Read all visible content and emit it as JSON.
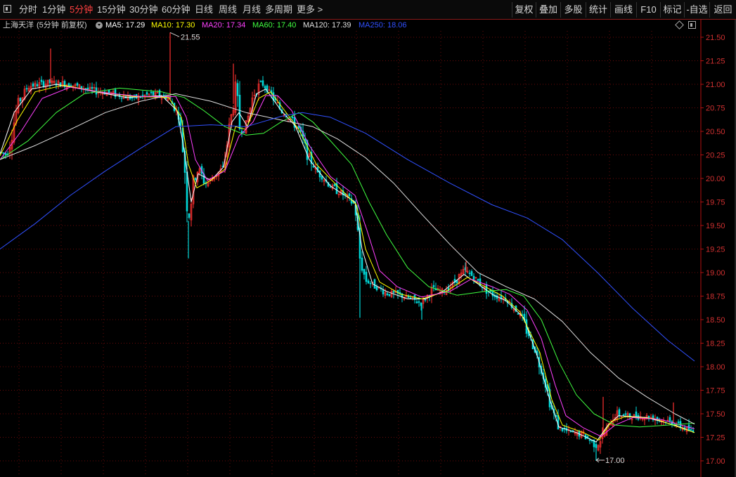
{
  "toolbar": {
    "periods": [
      "分时",
      "1分钟",
      "5分钟",
      "15分钟",
      "30分钟",
      "60分钟",
      "日线",
      "周线",
      "月线",
      "多周期",
      "更多 >"
    ],
    "active_period": "5分钟",
    "right_buttons": [
      "复权",
      "叠加",
      "多股",
      "统计",
      "画线",
      "F10",
      "标记",
      "-自选",
      "返回"
    ]
  },
  "indicator": {
    "stock_name": "上海天洋",
    "period_label": "(5分钟 前复权)",
    "ma": [
      {
        "label": "MA5: 17.29",
        "color": "#ffffff"
      },
      {
        "label": "MA10: 17.30",
        "color": "#ffff00"
      },
      {
        "label": "MA20: 17.34",
        "color": "#ff40ff"
      },
      {
        "label": "MA60: 17.40",
        "color": "#40ff40"
      },
      {
        "label": "MA120: 17.39",
        "color": "#e0e0e0"
      },
      {
        "label": "MA250: 18.06",
        "color": "#3050ff"
      }
    ]
  },
  "colors": {
    "up": "#ff3030",
    "down": "#00d8d8",
    "axis": "#b01010",
    "grid": "#6a0a0a",
    "axis_text": "#d03030"
  },
  "chart_data": {
    "type": "candlestick",
    "y_axis_ticks": [
      "21.50",
      "21.25",
      "21.00",
      "20.75",
      "20.50",
      "20.25",
      "20.00",
      "19.75",
      "19.50",
      "19.25",
      "19.00",
      "18.75",
      "18.50",
      "18.25",
      "18.00",
      "17.75",
      "17.50",
      "17.25",
      "17.00"
    ],
    "ylim": [
      16.96,
      21.68
    ],
    "annotations": {
      "high_label": "21.55",
      "high_value": 21.55,
      "low_label": "17.00",
      "low_value": 17.0
    },
    "price_path": [
      [
        0,
        20.28
      ],
      [
        10,
        20.25
      ],
      [
        25,
        20.78
      ],
      [
        40,
        20.98
      ],
      [
        70,
        21.02
      ],
      [
        100,
        21.0
      ],
      [
        130,
        20.94
      ],
      [
        160,
        20.9
      ],
      [
        190,
        20.85
      ],
      [
        215,
        20.9
      ],
      [
        240,
        20.86
      ],
      [
        255,
        20.66
      ],
      [
        262,
        20.2
      ],
      [
        268,
        19.55
      ],
      [
        274,
        19.9
      ],
      [
        282,
        20.12
      ],
      [
        292,
        19.94
      ],
      [
        305,
        20.02
      ],
      [
        318,
        20.12
      ],
      [
        328,
        20.62
      ],
      [
        335,
        20.92
      ],
      [
        342,
        20.5
      ],
      [
        350,
        20.56
      ],
      [
        360,
        20.88
      ],
      [
        372,
        21.02
      ],
      [
        385,
        20.9
      ],
      [
        400,
        20.72
      ],
      [
        415,
        20.62
      ],
      [
        425,
        20.52
      ],
      [
        435,
        20.3
      ],
      [
        450,
        20.08
      ],
      [
        470,
        19.92
      ],
      [
        490,
        19.82
      ],
      [
        505,
        19.72
      ],
      [
        512,
        19.15
      ],
      [
        520,
        18.92
      ],
      [
        535,
        18.85
      ],
      [
        550,
        18.78
      ],
      [
        570,
        18.76
      ],
      [
        585,
        18.72
      ],
      [
        600,
        18.67
      ],
      [
        615,
        18.82
      ],
      [
        630,
        18.8
      ],
      [
        645,
        18.88
      ],
      [
        660,
        19.02
      ],
      [
        675,
        18.95
      ],
      [
        690,
        18.82
      ],
      [
        705,
        18.75
      ],
      [
        720,
        18.72
      ],
      [
        740,
        18.55
      ],
      [
        760,
        18.2
      ],
      [
        775,
        17.85
      ],
      [
        785,
        17.55
      ],
      [
        795,
        17.36
      ],
      [
        810,
        17.3
      ],
      [
        830,
        17.28
      ],
      [
        848,
        17.16
      ],
      [
        862,
        17.32
      ],
      [
        875,
        17.5
      ],
      [
        900,
        17.47
      ],
      [
        920,
        17.47
      ],
      [
        940,
        17.44
      ],
      [
        960,
        17.4
      ],
      [
        975,
        17.34
      ],
      [
        988,
        17.3
      ]
    ],
    "spikes": [
      [
        72,
        21.38
      ],
      [
        242,
        21.55
      ],
      [
        268,
        19.15
      ],
      [
        332,
        21.22
      ],
      [
        512,
        18.52
      ],
      [
        600,
        18.5
      ],
      [
        663,
        19.12
      ],
      [
        848,
        17.0
      ],
      [
        858,
        17.68
      ],
      [
        958,
        17.62
      ]
    ],
    "ma_series": [
      {
        "name": "MA5",
        "color": "#ffffff",
        "points": [
          [
            0,
            20.26
          ],
          [
            20,
            20.7
          ],
          [
            45,
            20.95
          ],
          [
            80,
            21.0
          ],
          [
            130,
            20.93
          ],
          [
            180,
            20.86
          ],
          [
            230,
            20.88
          ],
          [
            252,
            20.72
          ],
          [
            262,
            20.3
          ],
          [
            272,
            19.75
          ],
          [
            282,
            20.05
          ],
          [
            300,
            19.98
          ],
          [
            318,
            20.12
          ],
          [
            330,
            20.6
          ],
          [
            340,
            20.7
          ],
          [
            352,
            20.55
          ],
          [
            365,
            20.9
          ],
          [
            378,
            20.95
          ],
          [
            400,
            20.72
          ],
          [
            420,
            20.56
          ],
          [
            440,
            20.2
          ],
          [
            470,
            19.92
          ],
          [
            505,
            19.75
          ],
          [
            515,
            19.25
          ],
          [
            530,
            18.88
          ],
          [
            550,
            18.8
          ],
          [
            580,
            18.72
          ],
          [
            605,
            18.72
          ],
          [
            630,
            18.8
          ],
          [
            660,
            18.98
          ],
          [
            680,
            18.88
          ],
          [
            700,
            18.77
          ],
          [
            720,
            18.7
          ],
          [
            745,
            18.52
          ],
          [
            765,
            18.1
          ],
          [
            780,
            17.7
          ],
          [
            795,
            17.36
          ],
          [
            820,
            17.3
          ],
          [
            848,
            17.2
          ],
          [
            865,
            17.38
          ],
          [
            880,
            17.48
          ],
          [
            920,
            17.46
          ],
          [
            960,
            17.38
          ],
          [
            988,
            17.3
          ]
        ]
      },
      {
        "name": "MA10",
        "color": "#ffff00",
        "points": [
          [
            0,
            20.24
          ],
          [
            25,
            20.62
          ],
          [
            50,
            20.92
          ],
          [
            90,
            20.99
          ],
          [
            140,
            20.92
          ],
          [
            190,
            20.87
          ],
          [
            240,
            20.86
          ],
          [
            258,
            20.65
          ],
          [
            268,
            20.15
          ],
          [
            280,
            19.9
          ],
          [
            300,
            19.98
          ],
          [
            320,
            20.1
          ],
          [
            335,
            20.55
          ],
          [
            350,
            20.52
          ],
          [
            368,
            20.85
          ],
          [
            385,
            20.92
          ],
          [
            405,
            20.72
          ],
          [
            425,
            20.52
          ],
          [
            450,
            20.15
          ],
          [
            480,
            19.92
          ],
          [
            507,
            19.72
          ],
          [
            520,
            19.25
          ],
          [
            540,
            18.9
          ],
          [
            570,
            18.77
          ],
          [
            600,
            18.72
          ],
          [
            635,
            18.8
          ],
          [
            665,
            18.95
          ],
          [
            690,
            18.85
          ],
          [
            715,
            18.75
          ],
          [
            740,
            18.58
          ],
          [
            768,
            18.15
          ],
          [
            785,
            17.65
          ],
          [
            800,
            17.38
          ],
          [
            830,
            17.3
          ],
          [
            852,
            17.22
          ],
          [
            870,
            17.42
          ],
          [
            890,
            17.47
          ],
          [
            930,
            17.45
          ],
          [
            965,
            17.36
          ],
          [
            988,
            17.3
          ]
        ]
      },
      {
        "name": "MA20",
        "color": "#ff40ff",
        "points": [
          [
            0,
            20.2
          ],
          [
            30,
            20.5
          ],
          [
            60,
            20.85
          ],
          [
            100,
            20.97
          ],
          [
            150,
            20.91
          ],
          [
            200,
            20.87
          ],
          [
            250,
            20.87
          ],
          [
            265,
            20.65
          ],
          [
            278,
            20.2
          ],
          [
            295,
            19.98
          ],
          [
            320,
            20.08
          ],
          [
            340,
            20.45
          ],
          [
            360,
            20.6
          ],
          [
            378,
            20.88
          ],
          [
            395,
            20.88
          ],
          [
            415,
            20.72
          ],
          [
            440,
            20.35
          ],
          [
            470,
            20.02
          ],
          [
            505,
            19.82
          ],
          [
            522,
            19.45
          ],
          [
            540,
            19.02
          ],
          [
            565,
            18.85
          ],
          [
            600,
            18.74
          ],
          [
            640,
            18.8
          ],
          [
            670,
            18.93
          ],
          [
            700,
            18.85
          ],
          [
            725,
            18.77
          ],
          [
            750,
            18.6
          ],
          [
            770,
            18.3
          ],
          [
            790,
            17.8
          ],
          [
            805,
            17.48
          ],
          [
            830,
            17.35
          ],
          [
            855,
            17.26
          ],
          [
            875,
            17.38
          ],
          [
            900,
            17.46
          ],
          [
            940,
            17.44
          ],
          [
            988,
            17.34
          ]
        ]
      },
      {
        "name": "MA60",
        "color": "#40ff40",
        "points": [
          [
            0,
            20.2
          ],
          [
            40,
            20.4
          ],
          [
            80,
            20.7
          ],
          [
            120,
            20.9
          ],
          [
            170,
            20.96
          ],
          [
            230,
            20.92
          ],
          [
            262,
            20.86
          ],
          [
            290,
            20.72
          ],
          [
            320,
            20.55
          ],
          [
            350,
            20.46
          ],
          [
            375,
            20.48
          ],
          [
            400,
            20.6
          ],
          [
            425,
            20.7
          ],
          [
            445,
            20.6
          ],
          [
            470,
            20.4
          ],
          [
            500,
            20.15
          ],
          [
            525,
            19.75
          ],
          [
            550,
            19.4
          ],
          [
            580,
            19.05
          ],
          [
            610,
            18.85
          ],
          [
            650,
            18.76
          ],
          [
            690,
            18.8
          ],
          [
            720,
            18.82
          ],
          [
            745,
            18.75
          ],
          [
            770,
            18.5
          ],
          [
            795,
            18.05
          ],
          [
            820,
            17.7
          ],
          [
            845,
            17.5
          ],
          [
            875,
            17.38
          ],
          [
            910,
            17.36
          ],
          [
            950,
            17.38
          ],
          [
            988,
            17.4
          ]
        ]
      },
      {
        "name": "MA120",
        "color": "#e0e0e0",
        "points": [
          [
            0,
            20.2
          ],
          [
            50,
            20.35
          ],
          [
            100,
            20.52
          ],
          [
            150,
            20.7
          ],
          [
            200,
            20.82
          ],
          [
            250,
            20.9
          ],
          [
            300,
            20.82
          ],
          [
            350,
            20.7
          ],
          [
            400,
            20.62
          ],
          [
            445,
            20.55
          ],
          [
            480,
            20.42
          ],
          [
            520,
            20.22
          ],
          [
            560,
            19.95
          ],
          [
            600,
            19.62
          ],
          [
            640,
            19.3
          ],
          [
            680,
            19.0
          ],
          [
            720,
            18.85
          ],
          [
            760,
            18.72
          ],
          [
            800,
            18.48
          ],
          [
            840,
            18.15
          ],
          [
            880,
            17.88
          ],
          [
            920,
            17.68
          ],
          [
            960,
            17.5
          ],
          [
            988,
            17.39
          ]
        ]
      },
      {
        "name": "MA250",
        "color": "#3050ff",
        "points": [
          [
            0,
            19.25
          ],
          [
            50,
            19.52
          ],
          [
            100,
            19.82
          ],
          [
            150,
            20.08
          ],
          [
            200,
            20.32
          ],
          [
            250,
            20.55
          ],
          [
            300,
            20.57
          ],
          [
            350,
            20.55
          ],
          [
            400,
            20.66
          ],
          [
            430,
            20.7
          ],
          [
            470,
            20.65
          ],
          [
            520,
            20.48
          ],
          [
            580,
            20.2
          ],
          [
            640,
            19.95
          ],
          [
            700,
            19.72
          ],
          [
            750,
            19.58
          ],
          [
            800,
            19.35
          ],
          [
            850,
            19.0
          ],
          [
            900,
            18.62
          ],
          [
            950,
            18.28
          ],
          [
            988,
            18.06
          ]
        ]
      }
    ]
  }
}
